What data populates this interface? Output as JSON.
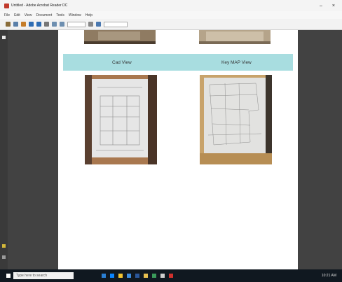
{
  "window": {
    "title": "Untitled - Adobe Acrobat Reader DC"
  },
  "menu": [
    "File",
    "Edit",
    "View",
    "Document",
    "Tools",
    "Window",
    "Help"
  ],
  "document": {
    "left_label": "Cad View",
    "right_label": "Key MAP View"
  },
  "taskbar": {
    "search_placeholder": "Type here to search",
    "clock": "10:21 AM"
  },
  "colors": {
    "banner": "#a8dde0",
    "gutter": "#424242",
    "taskbar": "#101820"
  },
  "icons": [
    "app-icon",
    "print-icon",
    "search-icon",
    "chevron-down-icon",
    "thumbnail-icon",
    "attach-icon",
    "start-icon"
  ]
}
